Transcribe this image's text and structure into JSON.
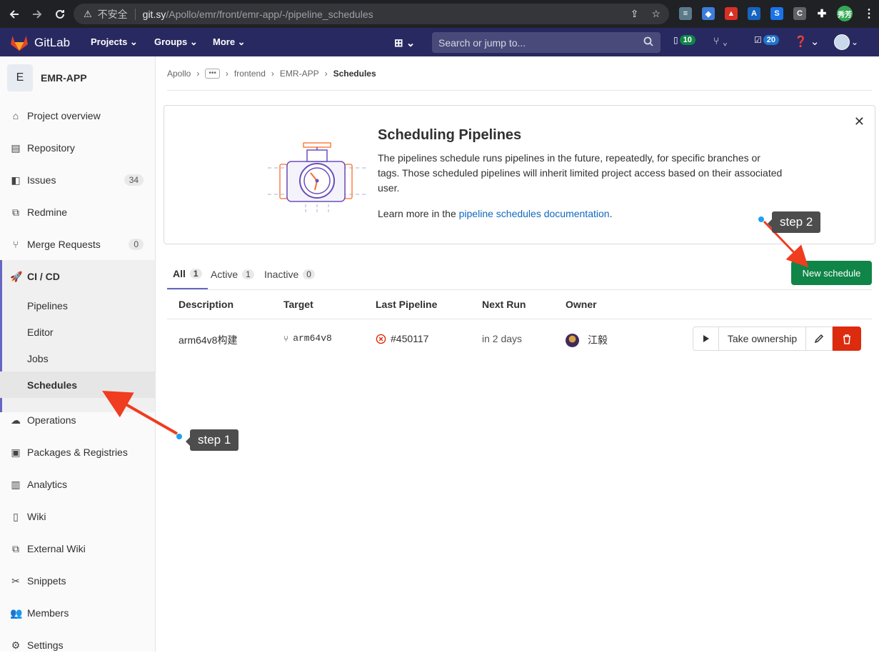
{
  "browser": {
    "insecure_label": "不安全",
    "url_domain": "git.sy",
    "url_path": "/Apollo/emr/front/emr-app/-/pipeline_schedules",
    "profile_label": "秀芳"
  },
  "gitlab_nav": {
    "brand": "GitLab",
    "projects": "Projects",
    "groups": "Groups",
    "more": "More",
    "search_placeholder": "Search or jump to...",
    "issues_count": "10",
    "todos_count": "20"
  },
  "sidebar": {
    "project_initial": "E",
    "project_name": "EMR-APP",
    "items": [
      {
        "label": "Project overview",
        "icon": "home-icon"
      },
      {
        "label": "Repository",
        "icon": "doc-icon"
      },
      {
        "label": "Issues",
        "icon": "issues-icon",
        "count": "34"
      },
      {
        "label": "Redmine",
        "icon": "external-link-icon"
      },
      {
        "label": "Merge Requests",
        "icon": "merge-request-icon",
        "count": "0"
      },
      {
        "label": "CI / CD",
        "icon": "rocket-icon"
      },
      {
        "label": "Operations",
        "icon": "cloud-gear-icon"
      },
      {
        "label": "Packages & Registries",
        "icon": "package-icon"
      },
      {
        "label": "Analytics",
        "icon": "chart-icon"
      },
      {
        "label": "Wiki",
        "icon": "book-icon"
      },
      {
        "label": "External Wiki",
        "icon": "external-link-icon"
      },
      {
        "label": "Snippets",
        "icon": "scissors-icon"
      },
      {
        "label": "Members",
        "icon": "users-icon"
      },
      {
        "label": "Settings",
        "icon": "gear-icon"
      }
    ],
    "cicd_sub": [
      "Pipelines",
      "Editor",
      "Jobs",
      "Schedules"
    ]
  },
  "breadcrumb": [
    "Apollo",
    "frontend",
    "EMR-APP",
    "Schedules"
  ],
  "banner": {
    "title": "Scheduling Pipelines",
    "body": "The pipelines schedule runs pipelines in the future, repeatedly, for specific branches or tags. Those scheduled pipelines will inherit limited project access based on their associated user.",
    "learn_prefix": "Learn more in the ",
    "learn_link": "pipeline schedules documentation",
    "learn_suffix": "."
  },
  "tabs": [
    {
      "label": "All",
      "count": "1"
    },
    {
      "label": "Active",
      "count": "1"
    },
    {
      "label": "Inactive",
      "count": "0"
    }
  ],
  "new_schedule_label": "New schedule",
  "table": {
    "headers": [
      "Description",
      "Target",
      "Last Pipeline",
      "Next Run",
      "Owner"
    ],
    "rows": [
      {
        "description": "arm64v8构建",
        "target": "arm64v8",
        "last_pipeline": "#450117",
        "next_run": "in 2 days",
        "owner": "江毅",
        "take_ownership": "Take ownership"
      }
    ]
  },
  "annotations": {
    "step1": "step 1",
    "step2": "step 2",
    "arrow_color": "#f03c1f"
  }
}
